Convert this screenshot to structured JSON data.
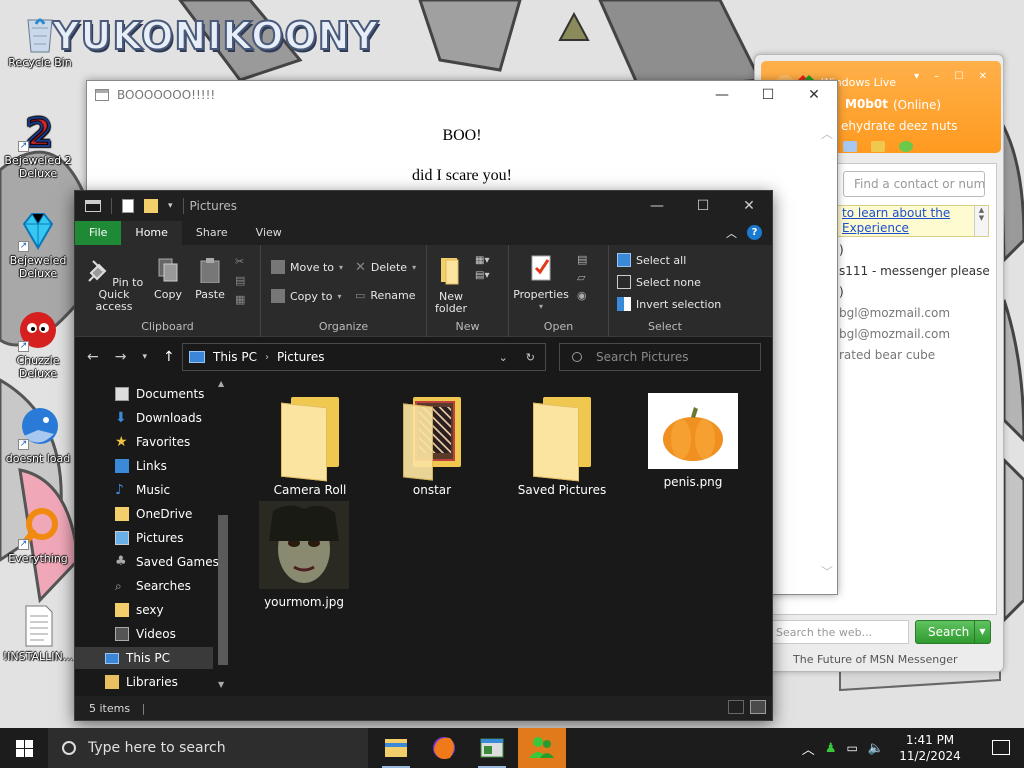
{
  "wallpaper": {
    "brand": "YUKONIKOONY"
  },
  "desktop_icons": [
    {
      "label": "Recycle Bin",
      "icon": "recycle-bin-icon"
    },
    {
      "label": "Bejeweled 2 Deluxe",
      "icon": "bejeweled2-icon"
    },
    {
      "label": "Bejeweled Deluxe",
      "icon": "bejeweled-icon"
    },
    {
      "label": "Chuzzle Deluxe",
      "icon": "chuzzle-icon"
    },
    {
      "label": "doesnt load",
      "icon": "thunderbird-icon"
    },
    {
      "label": "Everything",
      "icon": "everything-search-icon"
    },
    {
      "label": "!INSTALLIN...",
      "icon": "text-document-icon"
    }
  ],
  "boo_window": {
    "title": "BOOOOOOO!!!!!",
    "line1": "BOO!",
    "line2": "did I scare you!"
  },
  "messenger": {
    "title": "Windows Live",
    "username": "M0b0t",
    "status": "(Online)",
    "personal_message": "ehydrate deez nuts",
    "search_placeholder": "Find a contact or number",
    "ad_line1": "to learn about the",
    "ad_line2": "Experience",
    "contacts": [
      ")",
      "s111 - messenger please",
      ")",
      "bgl@mozmail.com",
      "bgl@mozmail.com",
      "rated bear cube"
    ],
    "web_search_placeholder": "Search the web...",
    "search_button": "Search",
    "footer": "The Future of MSN Messenger"
  },
  "explorer": {
    "title": "Pictures",
    "tabs": [
      "File",
      "Home",
      "Share",
      "View"
    ],
    "ribbon": {
      "clipboard": {
        "pin": "Pin to Quick access",
        "copy": "Copy",
        "paste": "Paste",
        "group": "Clipboard"
      },
      "organize": {
        "move_to": "Move to",
        "copy_to": "Copy to",
        "delete": "Delete",
        "rename": "Rename",
        "group": "Organize"
      },
      "new": {
        "new_folder": "New folder",
        "group": "New"
      },
      "open": {
        "properties": "Properties",
        "group": "Open"
      },
      "select": {
        "select_all": "Select all",
        "select_none": "Select none",
        "invert": "Invert selection",
        "group": "Select"
      }
    },
    "address": {
      "root": "This PC",
      "current": "Pictures"
    },
    "search_placeholder": "Search Pictures",
    "nav_items": [
      {
        "label": "Documents",
        "icon": "documents-icon"
      },
      {
        "label": "Downloads",
        "icon": "downloads-icon"
      },
      {
        "label": "Favorites",
        "icon": "favorites-star-icon"
      },
      {
        "label": "Links",
        "icon": "links-icon"
      },
      {
        "label": "Music",
        "icon": "music-icon"
      },
      {
        "label": "OneDrive",
        "icon": "folder-icon"
      },
      {
        "label": "Pictures",
        "icon": "pictures-icon"
      },
      {
        "label": "Saved Games",
        "icon": "saved-games-icon"
      },
      {
        "label": "Searches",
        "icon": "searches-icon"
      },
      {
        "label": "sexy",
        "icon": "folder-icon"
      },
      {
        "label": "Videos",
        "icon": "videos-icon"
      },
      {
        "label": "This PC",
        "icon": "this-pc-icon",
        "selected": true
      },
      {
        "label": "Libraries",
        "icon": "libraries-icon"
      }
    ],
    "files": [
      {
        "name": "Camera Roll",
        "type": "folder"
      },
      {
        "name": "onstar",
        "type": "folder-with-content"
      },
      {
        "name": "Saved Pictures",
        "type": "folder"
      },
      {
        "name": "penis.png",
        "type": "image-pumpkin"
      },
      {
        "name": "yourmom.jpg",
        "type": "image-face"
      }
    ],
    "status": "5 items"
  },
  "taskbar": {
    "search_placeholder": "Type here to search",
    "time": "1:41 PM",
    "date": "11/2/2024"
  },
  "colors": {
    "explorer_bg": "#191919",
    "file_tab": "#1e8a36",
    "msn_header": "#ff9a1f",
    "taskbar": "#1c1c1c",
    "active_taskbar_app": "#e07a1a"
  }
}
